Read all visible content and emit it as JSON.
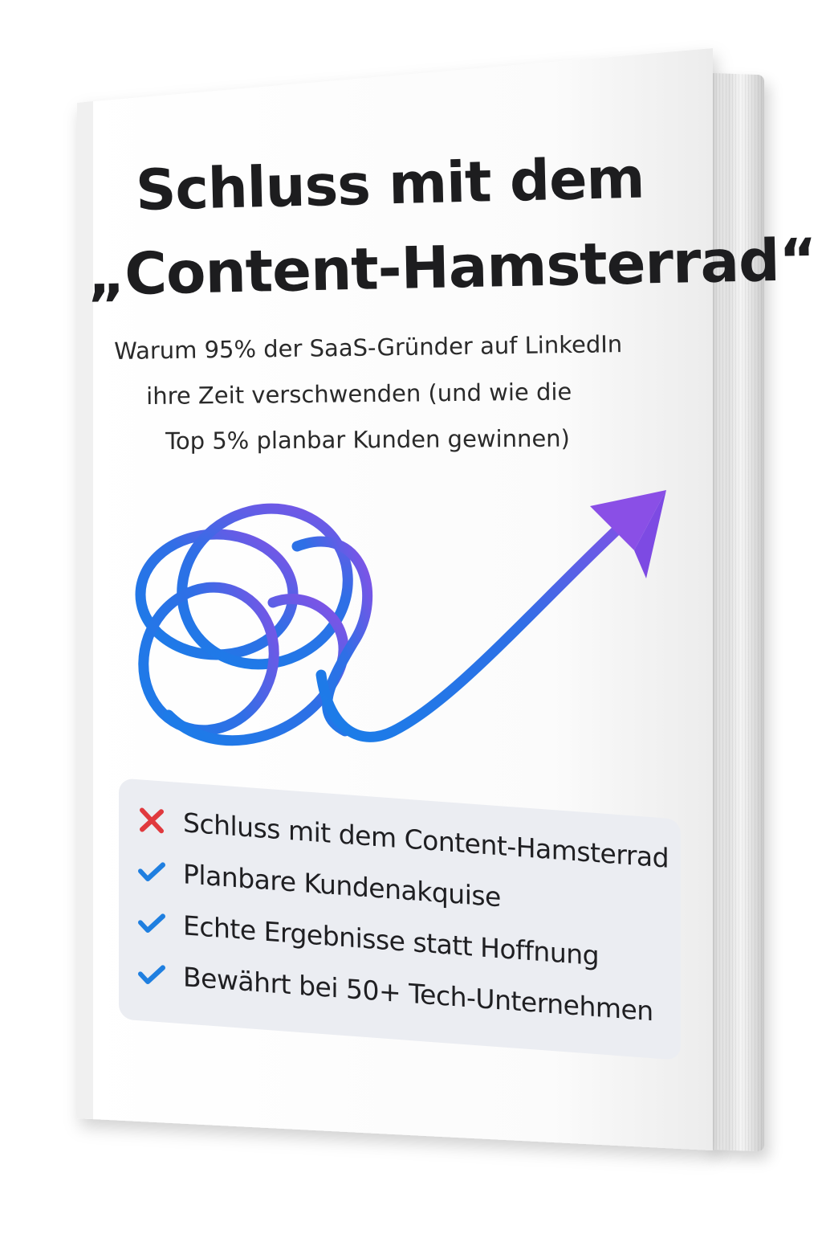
{
  "cover": {
    "title_line1": "Schluss mit dem",
    "title_line2": "„Content-Hamsterrad“",
    "subtitle_line1": "Warum 95% der SaaS-Gründer auf LinkedIn",
    "subtitle_line2": "ihre Zeit verschwenden (und wie die",
    "subtitle_line3": "Top 5% planbar Kunden gewinnen)"
  },
  "illustration": {
    "icon": "tangled-line-to-arrow-icon",
    "gradient_start": "#1a7de8",
    "gradient_end": "#8a4fe6"
  },
  "features": [
    {
      "icon": "x-mark-icon",
      "text": "Schluss mit dem Content-Hamsterrad",
      "color": "#e0393e"
    },
    {
      "icon": "check-icon",
      "text": "Planbare Kundenakquise",
      "color": "#1f7fe0"
    },
    {
      "icon": "check-icon",
      "text": "Echte Ergebnisse statt Hoffnung",
      "color": "#1f7fe0"
    },
    {
      "icon": "check-icon",
      "text": "Bewährt bei 50+ Tech-Unternehmen",
      "color": "#1f7fe0"
    }
  ],
  "colors": {
    "cover": "#fbfbfb",
    "pages": "#e4e4e4",
    "panel": "#ebedf2",
    "title": "#1d1d1f"
  }
}
